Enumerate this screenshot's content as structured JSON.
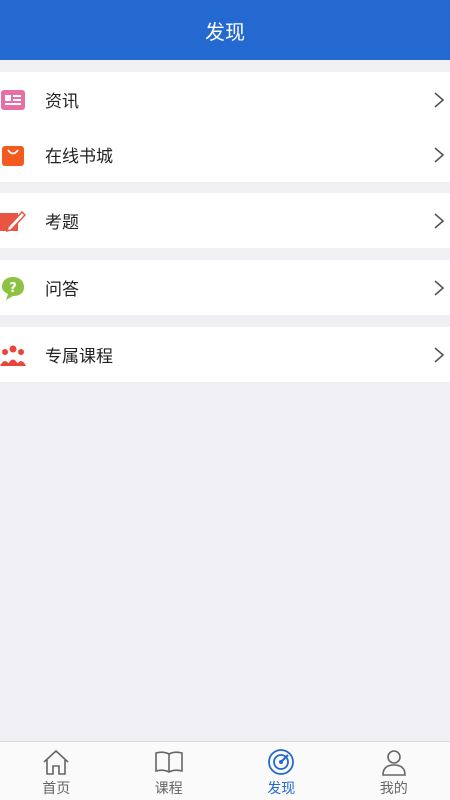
{
  "header": {
    "title": "发现"
  },
  "groups": [
    {
      "items": [
        {
          "label": "资讯",
          "icon": "news-icon",
          "color": "#e66fa6"
        },
        {
          "label": "在线书城",
          "icon": "shopping-bag-icon",
          "color": "#f25a1f"
        }
      ]
    },
    {
      "items": [
        {
          "label": "考题",
          "icon": "pencil-paper-icon",
          "color": "#e85545"
        }
      ]
    },
    {
      "items": [
        {
          "label": "问答",
          "icon": "question-bubble-icon",
          "color": "#8dc342"
        }
      ]
    },
    {
      "items": [
        {
          "label": "专属课程",
          "icon": "group-people-icon",
          "color": "#e8443a"
        }
      ]
    }
  ],
  "tabbar": {
    "tabs": [
      {
        "label": "首页",
        "icon": "home-icon",
        "active": false
      },
      {
        "label": "课程",
        "icon": "book-icon",
        "active": false
      },
      {
        "label": "发现",
        "icon": "discover-icon",
        "active": true
      },
      {
        "label": "我的",
        "icon": "user-icon",
        "active": false
      }
    ],
    "active_color": "#2369cf",
    "inactive_color": "#666666"
  },
  "colors": {
    "header_bg": "#2369cf",
    "page_bg": "#efeff4"
  }
}
